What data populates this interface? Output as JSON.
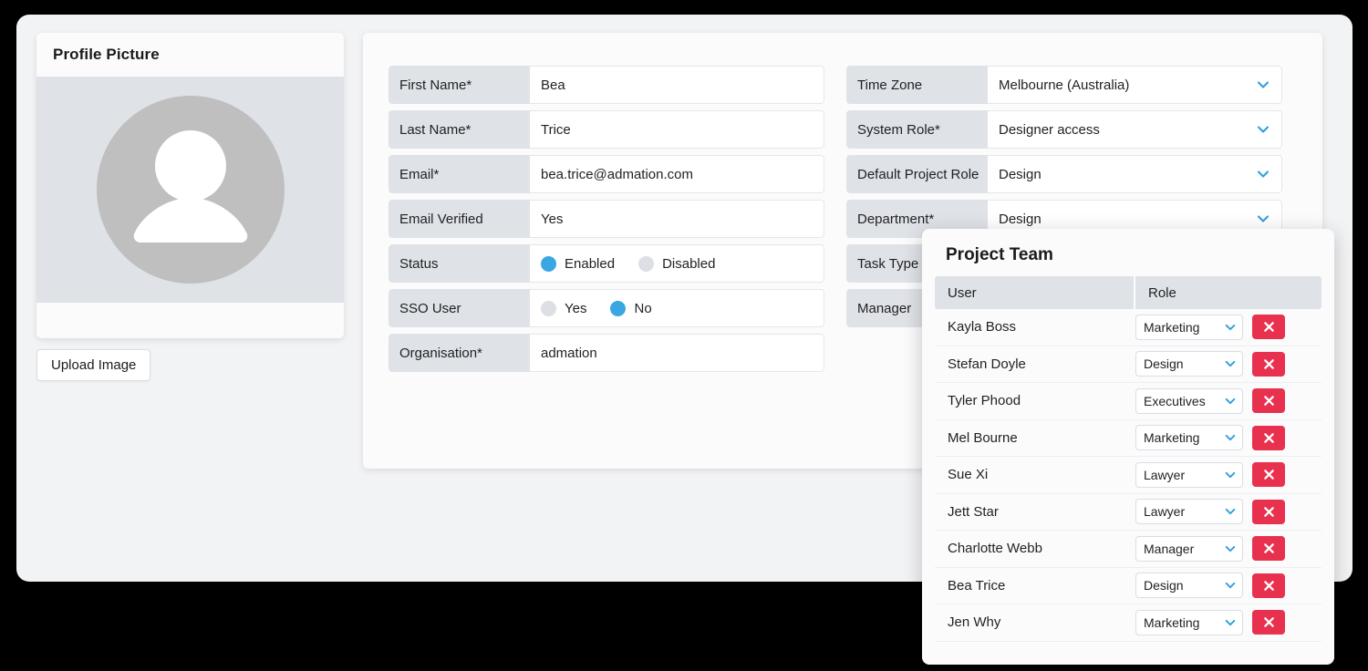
{
  "profile_card": {
    "title": "Profile Picture",
    "avatar_icon": "user-avatar-icon",
    "upload_label": "Upload Image"
  },
  "form": {
    "left_column": [
      {
        "label": "First Name*",
        "value": "Bea",
        "type": "text"
      },
      {
        "label": "Last Name*",
        "value": "Trice",
        "type": "text"
      },
      {
        "label": "Email*",
        "value": "bea.trice@admation.com",
        "type": "text"
      },
      {
        "label": "Email Verified",
        "value": "Yes",
        "type": "text"
      },
      {
        "label": "Status",
        "type": "radio",
        "options": [
          {
            "label": "Enabled",
            "selected": true
          },
          {
            "label": "Disabled",
            "selected": false
          }
        ]
      },
      {
        "label": "SSO User",
        "type": "radio",
        "options": [
          {
            "label": "Yes",
            "selected": false
          },
          {
            "label": "No",
            "selected": true
          }
        ]
      },
      {
        "label": "Organisation*",
        "value": "admation",
        "type": "text"
      }
    ],
    "right_column": [
      {
        "label": "Time Zone",
        "value": "Melbourne (Australia)",
        "type": "select"
      },
      {
        "label": "System Role*",
        "value": "Designer access",
        "type": "select"
      },
      {
        "label": "Default Project Role",
        "value": "Design",
        "type": "select"
      },
      {
        "label": "Department*",
        "value": "Design",
        "type": "select"
      },
      {
        "label": "Task Type",
        "value": "",
        "type": "select"
      },
      {
        "label": "Manager",
        "value": "",
        "type": "select"
      }
    ]
  },
  "project_team": {
    "title": "Project Team",
    "columns": {
      "user": "User",
      "role": "Role"
    },
    "remove_icon": "close-x-icon",
    "rows": [
      {
        "user": "Kayla Boss",
        "role": "Marketing"
      },
      {
        "user": "Stefan Doyle",
        "role": "Design"
      },
      {
        "user": "Tyler Phood",
        "role": "Executives"
      },
      {
        "user": "Mel Bourne",
        "role": "Marketing"
      },
      {
        "user": "Sue Xi",
        "role": "Lawyer"
      },
      {
        "user": "Jett Star",
        "role": "Lawyer"
      },
      {
        "user": "Charlotte Webb",
        "role": "Manager"
      },
      {
        "user": "Bea Trice",
        "role": "Design"
      },
      {
        "user": "Jen Why",
        "role": "Marketing"
      }
    ]
  },
  "colors": {
    "accent_blue": "#3aa7e3",
    "danger_red": "#e8314e",
    "label_gray": "#dfe2e7",
    "page_bg": "#f2f3f5"
  }
}
